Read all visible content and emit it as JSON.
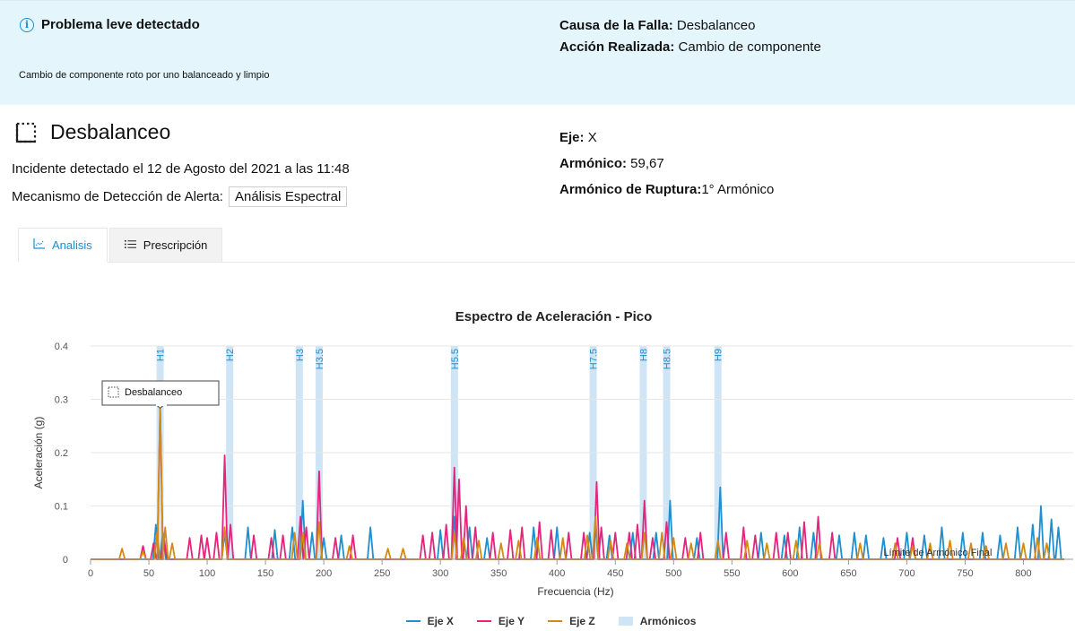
{
  "banner": {
    "title": "Problema leve detectado",
    "description": "Cambio de componente roto por uno balanceado y limpio",
    "cause_label": "Causa de la Falla:",
    "cause_value": "Desbalanceo",
    "action_label": "Acción Realizada:",
    "action_value": "Cambio de componente",
    "icon": "info-icon"
  },
  "incident": {
    "title": "Desbalanceo",
    "detected_text": "Incidente detectado el 12 de Agosto del 2021 a las 11:48",
    "mechanism_label": "Mecanismo de Detección de Alerta:",
    "mechanism_value": "Análisis Espectral",
    "axis_label": "Eje:",
    "axis_value": "X",
    "harmonic_label": "Armónico:",
    "harmonic_value": "59,67",
    "rupture_label": "Armónico de Ruptura:",
    "rupture_value": "1° Armónico"
  },
  "tabs": [
    {
      "label": "Analisis",
      "active": true,
      "icon": "chart-icon"
    },
    {
      "label": "Prescripción",
      "active": false,
      "icon": "list-icon"
    }
  ],
  "colors": {
    "eje_x": "#1f8fcf",
    "eje_y": "#e5247c",
    "eje_z": "#d48a12",
    "armonicos": "#cfe5f5",
    "accent": "#1a8fd6"
  },
  "chart_data": {
    "type": "line",
    "title": "Espectro de Aceleración - Pico",
    "xlabel": "Frecuencia (Hz)",
    "ylabel": "Aceleración (g)",
    "xlim": [
      0,
      835
    ],
    "ylim": [
      0,
      0.4
    ],
    "xticks": [
      0,
      50,
      100,
      150,
      200,
      250,
      300,
      350,
      400,
      450,
      500,
      550,
      600,
      650,
      700,
      750,
      800
    ],
    "yticks": [
      0,
      0.1,
      0.2,
      0.3,
      0.4
    ],
    "ytick_labels": [
      "0",
      "0.1",
      "0.2",
      "0.3",
      "0.4"
    ],
    "grid": true,
    "legend_position": "bottom",
    "harmonic_bands": [
      {
        "label": "H1",
        "x": 59.67
      },
      {
        "label": "H2",
        "x": 119.3
      },
      {
        "label": "H3",
        "x": 179
      },
      {
        "label": "H3.5",
        "x": 196
      },
      {
        "label": "H5.5",
        "x": 312
      },
      {
        "label": "H7.5",
        "x": 431
      },
      {
        "label": "H8",
        "x": 474
      },
      {
        "label": "H8.5",
        "x": 494
      },
      {
        "label": "H9",
        "x": 538
      }
    ],
    "annotation": {
      "text": "Desbalanceo",
      "x": 59.67,
      "y": 0.28
    },
    "overlay_text": "Límite de Armónico Final",
    "overlay_x": 680,
    "series": [
      {
        "name": "Eje X",
        "color": "#1f8fcf",
        "peaks": [
          [
            56,
            0.065
          ],
          [
            62,
            0.05
          ],
          [
            115,
            0.05
          ],
          [
            135,
            0.06
          ],
          [
            158,
            0.055
          ],
          [
            173,
            0.06
          ],
          [
            182,
            0.11
          ],
          [
            190,
            0.05
          ],
          [
            200,
            0.04
          ],
          [
            215,
            0.045
          ],
          [
            240,
            0.06
          ],
          [
            300,
            0.055
          ],
          [
            312,
            0.08
          ],
          [
            325,
            0.06
          ],
          [
            340,
            0.04
          ],
          [
            380,
            0.06
          ],
          [
            400,
            0.06
          ],
          [
            428,
            0.05
          ],
          [
            433,
            0.06
          ],
          [
            445,
            0.045
          ],
          [
            465,
            0.05
          ],
          [
            485,
            0.05
          ],
          [
            497,
            0.11
          ],
          [
            520,
            0.04
          ],
          [
            540,
            0.135
          ],
          [
            575,
            0.05
          ],
          [
            595,
            0.045
          ],
          [
            608,
            0.06
          ],
          [
            620,
            0.05
          ],
          [
            642,
            0.045
          ],
          [
            655,
            0.05
          ],
          [
            665,
            0.045
          ],
          [
            680,
            0.04
          ],
          [
            700,
            0.05
          ],
          [
            715,
            0.045
          ],
          [
            730,
            0.06
          ],
          [
            748,
            0.05
          ],
          [
            765,
            0.05
          ],
          [
            780,
            0.045
          ],
          [
            795,
            0.06
          ],
          [
            808,
            0.065
          ],
          [
            815,
            0.1
          ],
          [
            824,
            0.075
          ],
          [
            830,
            0.06
          ]
        ]
      },
      {
        "name": "Eje Y",
        "color": "#e5247c",
        "peaks": [
          [
            45,
            0.025
          ],
          [
            54,
            0.03
          ],
          [
            59.67,
            0.285
          ],
          [
            63,
            0.04
          ],
          [
            85,
            0.04
          ],
          [
            95,
            0.045
          ],
          [
            100,
            0.04
          ],
          [
            108,
            0.05
          ],
          [
            115,
            0.195
          ],
          [
            120,
            0.065
          ],
          [
            140,
            0.045
          ],
          [
            155,
            0.04
          ],
          [
            165,
            0.045
          ],
          [
            180,
            0.08
          ],
          [
            185,
            0.06
          ],
          [
            196,
            0.165
          ],
          [
            210,
            0.04
          ],
          [
            225,
            0.045
          ],
          [
            285,
            0.045
          ],
          [
            293,
            0.05
          ],
          [
            305,
            0.065
          ],
          [
            312,
            0.172
          ],
          [
            316,
            0.15
          ],
          [
            322,
            0.1
          ],
          [
            330,
            0.06
          ],
          [
            345,
            0.05
          ],
          [
            360,
            0.055
          ],
          [
            370,
            0.06
          ],
          [
            385,
            0.07
          ],
          [
            395,
            0.055
          ],
          [
            410,
            0.05
          ],
          [
            423,
            0.05
          ],
          [
            434,
            0.145
          ],
          [
            438,
            0.06
          ],
          [
            450,
            0.05
          ],
          [
            462,
            0.05
          ],
          [
            469,
            0.065
          ],
          [
            475,
            0.11
          ],
          [
            482,
            0.04
          ],
          [
            494,
            0.07
          ],
          [
            510,
            0.04
          ],
          [
            523,
            0.05
          ],
          [
            545,
            0.05
          ],
          [
            560,
            0.06
          ],
          [
            570,
            0.045
          ],
          [
            588,
            0.05
          ],
          [
            598,
            0.05
          ],
          [
            612,
            0.07
          ],
          [
            624,
            0.08
          ],
          [
            636,
            0.05
          ],
          [
            692,
            0.04
          ],
          [
            705,
            0.04
          ]
        ]
      },
      {
        "name": "Eje Z",
        "color": "#d48a12",
        "peaks": [
          [
            27,
            0.02
          ],
          [
            45,
            0.015
          ],
          [
            57,
            0.05
          ],
          [
            59.67,
            0.29
          ],
          [
            64,
            0.06
          ],
          [
            70,
            0.03
          ],
          [
            115,
            0.06
          ],
          [
            175,
            0.05
          ],
          [
            182,
            0.05
          ],
          [
            196,
            0.07
          ],
          [
            222,
            0.025
          ],
          [
            255,
            0.02
          ],
          [
            268,
            0.02
          ],
          [
            312,
            0.05
          ],
          [
            320,
            0.04
          ],
          [
            333,
            0.035
          ],
          [
            352,
            0.03
          ],
          [
            367,
            0.035
          ],
          [
            383,
            0.04
          ],
          [
            405,
            0.04
          ],
          [
            426,
            0.045
          ],
          [
            433,
            0.08
          ],
          [
            446,
            0.035
          ],
          [
            460,
            0.03
          ],
          [
            475,
            0.05
          ],
          [
            490,
            0.05
          ],
          [
            500,
            0.04
          ],
          [
            515,
            0.03
          ],
          [
            538,
            0.035
          ],
          [
            563,
            0.035
          ],
          [
            580,
            0.03
          ],
          [
            605,
            0.035
          ],
          [
            625,
            0.03
          ],
          [
            660,
            0.03
          ],
          [
            690,
            0.03
          ],
          [
            705,
            0.025
          ],
          [
            720,
            0.03
          ],
          [
            737,
            0.035
          ],
          [
            755,
            0.03
          ],
          [
            768,
            0.025
          ],
          [
            785,
            0.03
          ],
          [
            800,
            0.03
          ],
          [
            812,
            0.04
          ],
          [
            820,
            0.03
          ]
        ]
      }
    ],
    "legend": [
      {
        "name": "Eje X",
        "kind": "line",
        "color": "#1f8fcf"
      },
      {
        "name": "Eje Y",
        "kind": "line",
        "color": "#e5247c"
      },
      {
        "name": "Eje Z",
        "kind": "line",
        "color": "#d48a12"
      },
      {
        "name": "Armónicos",
        "kind": "box",
        "color": "#cfe5f5"
      }
    ]
  }
}
